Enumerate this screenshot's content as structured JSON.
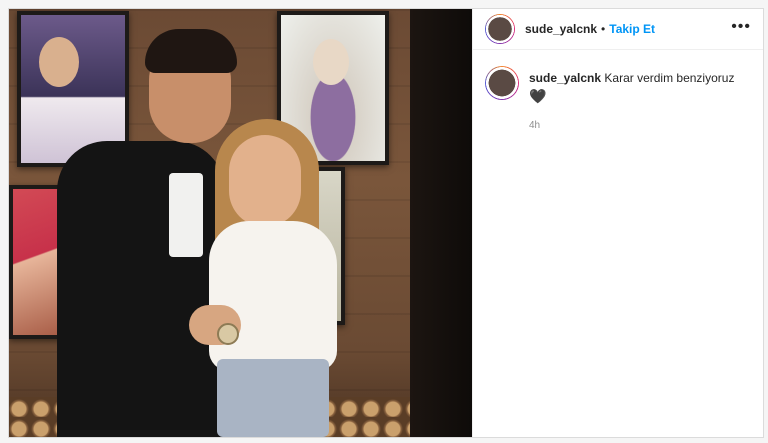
{
  "post": {
    "username": "sude_yalcnk",
    "separator": "•",
    "follow_label": "Takip Et",
    "more_icon": "more-options-icon",
    "caption": {
      "username": "sude_yalcnk",
      "text": "Karar verdim benziyoruz",
      "emoji": "🖤",
      "time": "4h"
    },
    "colors": {
      "follow": "#0095f6",
      "text": "#262626",
      "muted": "#8e8e8e"
    }
  }
}
